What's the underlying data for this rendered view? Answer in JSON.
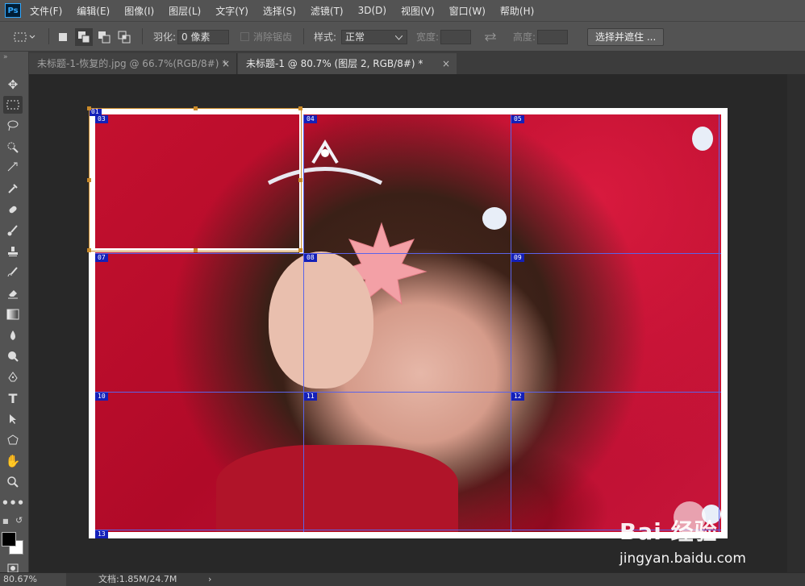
{
  "app": {
    "logo": "Ps"
  },
  "menu": [
    "文件(F)",
    "编辑(E)",
    "图像(I)",
    "图层(L)",
    "文字(Y)",
    "选择(S)",
    "滤镜(T)",
    "3D(D)",
    "视图(V)",
    "窗口(W)",
    "帮助(H)"
  ],
  "options": {
    "feather_label": "羽化:",
    "feather_value": "0 像素",
    "antialias_label": "消除锯齿",
    "style_label": "样式:",
    "style_value": "正常",
    "width_label": "宽度:",
    "height_label": "高度:",
    "select_mask_button": "选择并遮住 ..."
  },
  "tabs": [
    {
      "label": "未标题-1-恢复的.jpg @ 66.7%(RGB/8#) *",
      "close": "×",
      "active": false
    },
    {
      "label": "未标题-1 @ 80.7% (图层 2, RGB/8#) *",
      "close": "×",
      "active": true
    }
  ],
  "tools": [
    "move-tool-icon",
    "marquee-tool-icon",
    "lasso-tool-icon",
    "quick-select-tool-icon",
    "crop-tool-icon",
    "eyedropper-tool-icon",
    "healing-brush-tool-icon",
    "brush-tool-icon",
    "clone-stamp-tool-icon",
    "history-brush-tool-icon",
    "eraser-tool-icon",
    "gradient-tool-icon",
    "blur-tool-icon",
    "dodge-tool-icon",
    "pen-tool-icon",
    "type-tool-icon",
    "path-selection-tool-icon",
    "shape-tool-icon",
    "hand-tool-icon",
    "zoom-tool-icon",
    "more-tools-icon"
  ],
  "colors": {
    "foreground": "#000000",
    "background": "#ffffff",
    "slice_line": "#5b63e8",
    "selection": "#c98a2a"
  },
  "slices": [
    "01",
    "03",
    "04",
    "05",
    "07",
    "08",
    "09",
    "10",
    "11",
    "12",
    "13"
  ],
  "watermark": {
    "brand": "Bai 经验",
    "url": "jingyan.baidu.com"
  },
  "status": {
    "zoom": "80.67%",
    "doc": "文档:1.85M/24.7M",
    "arrow": "›"
  }
}
